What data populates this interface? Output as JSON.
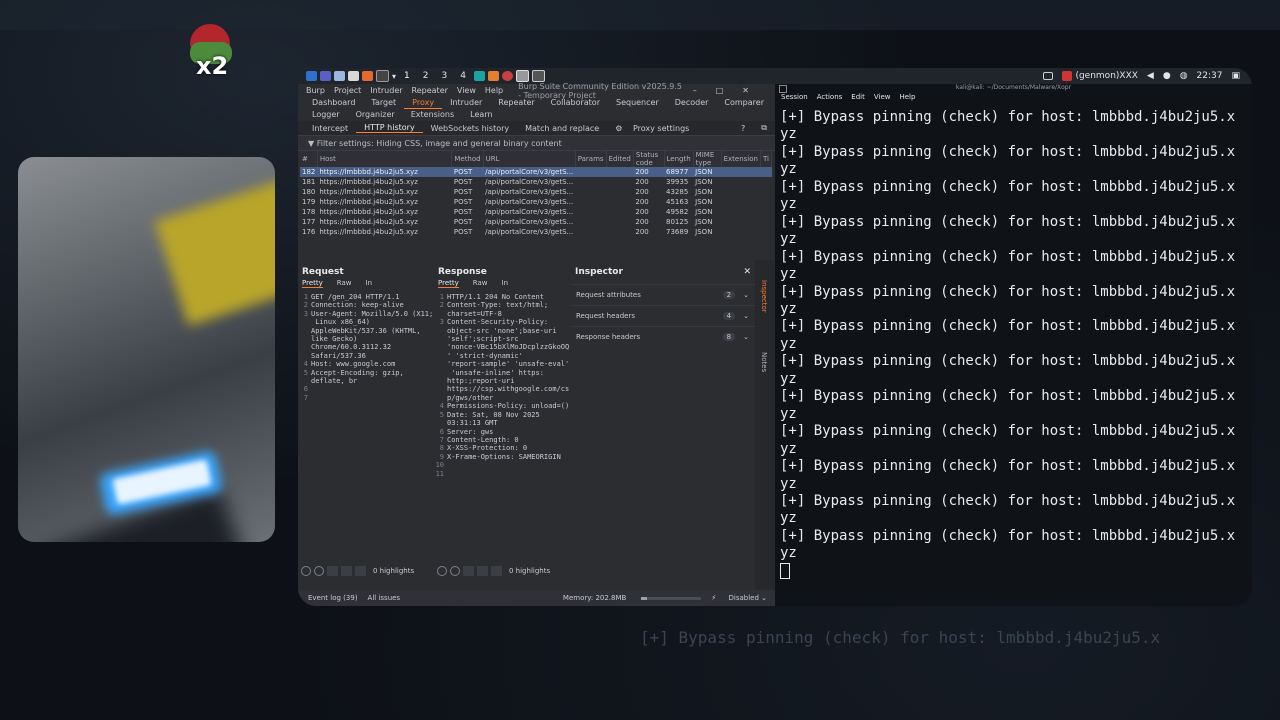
{
  "background": {
    "echo_text": "[+] Bypass pinning (check) for host: lmbbbd.j4bu2ju5.x"
  },
  "badge": {
    "text": "x2"
  },
  "taskbar": {
    "workspaces": [
      "1",
      "2",
      "3",
      "4"
    ],
    "active_workspace": "1",
    "user": "(genmon)XXX",
    "time": "22:37"
  },
  "burp": {
    "menu": [
      "Burp",
      "Project",
      "Intruder",
      "Repeater",
      "View",
      "Help"
    ],
    "window_title": "Burp Suite Community Edition v2025.9.5 - Temporary Project",
    "tabs1": [
      "Dashboard",
      "Target",
      "Proxy",
      "Intruder",
      "Repeater",
      "Collaborator",
      "Sequencer",
      "Decoder",
      "Comparer"
    ],
    "tabs1_active": "Proxy",
    "tabs2": [
      "Logger",
      "Organizer",
      "Extensions",
      "Learn"
    ],
    "proxy_tabs": [
      "Intercept",
      "HTTP history",
      "WebSockets history",
      "Match and replace"
    ],
    "proxy_tab_active": "HTTP history",
    "proxy_settings": "Proxy settings",
    "filter": "Filter settings: Hiding CSS, image and general binary content",
    "columns": [
      "#",
      "Host",
      "Method",
      "URL",
      "Params",
      "Edited",
      "Status code",
      "Length",
      "MIME type",
      "Extension",
      "Ti"
    ],
    "rows": [
      {
        "n": "182",
        "host": "https://lmbbbd.j4bu2ju5.xyz",
        "method": "POST",
        "url": "/api/portalCore/v3/getS...",
        "status": "200",
        "length": "68977",
        "mime": "JSON"
      },
      {
        "n": "181",
        "host": "https://lmbbbd.j4bu2ju5.xyz",
        "method": "POST",
        "url": "/api/portalCore/v3/getS...",
        "status": "200",
        "length": "39935",
        "mime": "JSON"
      },
      {
        "n": "180",
        "host": "https://lmbbbd.j4bu2ju5.xyz",
        "method": "POST",
        "url": "/api/portalCore/v3/getS...",
        "status": "200",
        "length": "43285",
        "mime": "JSON"
      },
      {
        "n": "179",
        "host": "https://lmbbbd.j4bu2ju5.xyz",
        "method": "POST",
        "url": "/api/portalCore/v3/getS...",
        "status": "200",
        "length": "45163",
        "mime": "JSON"
      },
      {
        "n": "178",
        "host": "https://lmbbbd.j4bu2ju5.xyz",
        "method": "POST",
        "url": "/api/portalCore/v3/getS...",
        "status": "200",
        "length": "49582",
        "mime": "JSON"
      },
      {
        "n": "177",
        "host": "https://lmbbbd.j4bu2ju5.xyz",
        "method": "POST",
        "url": "/api/portalCore/v3/getS...",
        "status": "200",
        "length": "80125",
        "mime": "JSON"
      },
      {
        "n": "176",
        "host": "https://lmbbbd.j4bu2ju5.xyz",
        "method": "POST",
        "url": "/api/portalCore/v3/getS...",
        "status": "200",
        "length": "73689",
        "mime": "JSON"
      }
    ],
    "request": {
      "title": "Request",
      "tabs": [
        "Pretty",
        "Raw",
        "In"
      ],
      "lines": [
        {
          "n": "1",
          "t": "GET /gen_204 HTTP/1.1"
        },
        {
          "n": "2",
          "t": "Connection: keep-alive"
        },
        {
          "n": "3",
          "t": "User-Agent: Mozilla/5.0 (X11;"
        },
        {
          "n": "",
          "t": " Linux x86_64)"
        },
        {
          "n": "",
          "t": "AppleWebKit/537.36 (KHTML,"
        },
        {
          "n": "",
          "t": "like Gecko)"
        },
        {
          "n": "",
          "t": "Chrome/60.0.3112.32"
        },
        {
          "n": "",
          "t": "Safari/537.36"
        },
        {
          "n": "4",
          "t": "Host: www.google.com"
        },
        {
          "n": "5",
          "t": "Accept-Encoding: gzip,"
        },
        {
          "n": "",
          "t": "deflate, br"
        },
        {
          "n": "6",
          "t": ""
        },
        {
          "n": "7",
          "t": ""
        }
      ],
      "highlights": "0 highlights"
    },
    "response": {
      "title": "Response",
      "tabs": [
        "Pretty",
        "Raw",
        "In"
      ],
      "lines": [
        {
          "n": "1",
          "t": "HTTP/1.1 204 No Content"
        },
        {
          "n": "2",
          "t": "Content-Type: text/html;"
        },
        {
          "n": "",
          "t": "charset=UTF-8"
        },
        {
          "n": "3",
          "t": "Content-Security-Policy:"
        },
        {
          "n": "",
          "t": "object-src 'none';base-uri"
        },
        {
          "n": "",
          "t": "'self';script-src"
        },
        {
          "n": "",
          "t": "'nonce-VBc15bXlMoJDcplzzGkoOQ"
        },
        {
          "n": "",
          "t": "' 'strict-dynamic'"
        },
        {
          "n": "",
          "t": "'report-sample' 'unsafe-eval'"
        },
        {
          "n": "",
          "t": " 'unsafe-inline' https:"
        },
        {
          "n": "",
          "t": "http:;report-uri"
        },
        {
          "n": "",
          "t": "https://csp.withgoogle.com/cs"
        },
        {
          "n": "",
          "t": "p/gws/other"
        },
        {
          "n": "4",
          "t": "Permissions-Policy: unload=()"
        },
        {
          "n": "5",
          "t": "Date: Sat, 08 Nov 2025"
        },
        {
          "n": "",
          "t": "03:31:13 GMT"
        },
        {
          "n": "6",
          "t": "Server: gws"
        },
        {
          "n": "7",
          "t": "Content-Length: 0"
        },
        {
          "n": "8",
          "t": "X-XSS-Protection: 0"
        },
        {
          "n": "9",
          "t": "X-Frame-Options: SAMEORIGIN"
        },
        {
          "n": "10",
          "t": ""
        },
        {
          "n": "11",
          "t": ""
        }
      ],
      "highlights": "0 highlights"
    },
    "inspector": {
      "title": "Inspector",
      "sections": [
        {
          "label": "Request attributes",
          "count": "2"
        },
        {
          "label": "Request headers",
          "count": "4"
        },
        {
          "label": "Response headers",
          "count": "8"
        }
      ],
      "side_tabs": [
        "Inspector",
        "Notes"
      ]
    },
    "status": {
      "event_log": "Event log (39)",
      "all_issues": "All issues",
      "memory": "Memory: 202.8MB",
      "memory_used_fraction": 0.1,
      "disabled": "Disabled"
    }
  },
  "terminal": {
    "title": "kali@kali: ~/Documents/Malware/Xopr",
    "menu": [
      "Session",
      "Actions",
      "Edit",
      "View",
      "Help"
    ],
    "lines": [
      "[+] Bypass pinning (check) for host: lmbbbd.j4bu2ju5.x",
      "yz",
      "[+] Bypass pinning (check) for host: lmbbbd.j4bu2ju5.x",
      "yz",
      "[+] Bypass pinning (check) for host: lmbbbd.j4bu2ju5.x",
      "yz",
      "[+] Bypass pinning (check) for host: lmbbbd.j4bu2ju5.x",
      "yz",
      "[+] Bypass pinning (check) for host: lmbbbd.j4bu2ju5.x",
      "yz",
      "[+] Bypass pinning (check) for host: lmbbbd.j4bu2ju5.x",
      "yz",
      "[+] Bypass pinning (check) for host: lmbbbd.j4bu2ju5.x",
      "yz",
      "[+] Bypass pinning (check) for host: lmbbbd.j4bu2ju5.x",
      "yz",
      "[+] Bypass pinning (check) for host: lmbbbd.j4bu2ju5.x",
      "yz",
      "[+] Bypass pinning (check) for host: lmbbbd.j4bu2ju5.x",
      "yz",
      "[+] Bypass pinning (check) for host: lmbbbd.j4bu2ju5.x",
      "yz",
      "[+] Bypass pinning (check) for host: lmbbbd.j4bu2ju5.x",
      "yz",
      "[+] Bypass pinning (check) for host: lmbbbd.j4bu2ju5.x",
      "yz"
    ]
  },
  "colors": {
    "accent": "#ff7a2f",
    "selected_row": "#4a5f88",
    "terminal_bg": "#0f1217"
  }
}
